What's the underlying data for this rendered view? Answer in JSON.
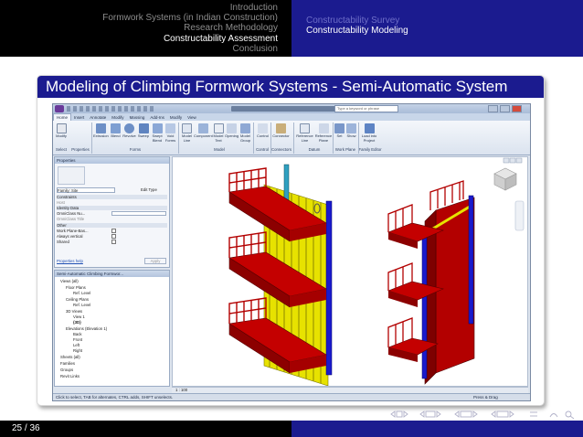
{
  "header": {
    "toc": [
      "Introduction",
      "Formwork Systems (in Indian Construction)",
      "Research Methodology",
      "Constructability Assessment",
      "Conclusion"
    ],
    "toc_current_index": 3,
    "subsections": [
      "Constructability Survey",
      "Constructability Modeling"
    ],
    "subsection_current_index": 1
  },
  "frame": {
    "title": "Modeling of Climbing Formwork Systems - Semi-Automatic System"
  },
  "revit": {
    "search_placeholder": "Type a keyword or phrase",
    "tabs": [
      "Home",
      "Insert",
      "Annotate",
      "Modify",
      "Massing",
      "Add-Ins",
      "Modify",
      "View"
    ],
    "active_tab": "Home",
    "ribbon_buttons": [
      "Modify",
      "Extrusion",
      "Blend",
      "Revolve",
      "Sweep",
      "Swept Blend",
      "Void Forms",
      "Model Line",
      "Component",
      "Model Text",
      "Opening",
      "Model Group",
      "Control",
      "Connector",
      "Reference Line",
      "Reference Plane",
      "Set",
      "Show",
      "Load into Project"
    ],
    "ribbon_groups": [
      "Select",
      "Properties",
      "Forms",
      "Model",
      "Control",
      "Connectors",
      "Datum",
      "Work Plane",
      "Family Editor"
    ],
    "properties": {
      "title": "Properties",
      "family_selector": "Family: Site",
      "edit_type": "Edit Type",
      "sections": [
        "Constraints",
        "Identity Data",
        "Other"
      ],
      "rows": [
        "Host",
        "OmniClass Nu...",
        "OmniClass Title",
        "Work Plane-Bas...",
        "Always vertical",
        "Shared"
      ],
      "help_link": "Properties help",
      "apply": "Apply"
    },
    "browser": {
      "title": "Semi-Automatic Climbing Formwor...",
      "items": [
        "Views (all)",
        "Floor Plans",
        "Ref. Level",
        "Ceiling Plans",
        "Ref. Level",
        "3D Views",
        "View 1",
        "{3D}",
        "Elevations (Elevation 1)",
        "Back",
        "Front",
        "Left",
        "Right",
        "Sheets (all)",
        "Families",
        "Groups",
        "Revit Links"
      ]
    },
    "view_scale": "1 : 100",
    "status_text": "Click to select, TAB for alternates, CTRL adds, SHIFT unselects.",
    "status_right": "Press & Drag"
  },
  "footer": {
    "page": "25 / 36"
  },
  "colors": {
    "beamer_blue": "#1b1b8f",
    "formwork_red": "#b30000",
    "panel_yellow": "#f2e600",
    "post_blue": "#1a1acc"
  }
}
